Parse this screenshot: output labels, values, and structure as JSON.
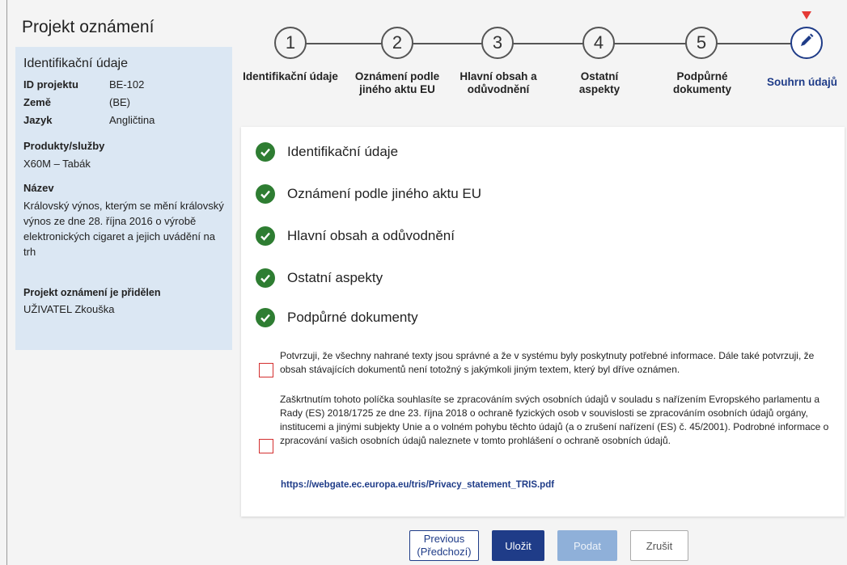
{
  "page": {
    "title": "Projekt oznámení"
  },
  "info": {
    "heading": "Identifikační údaje",
    "fields": [
      {
        "key": "ID projektu",
        "value": "BE-102"
      },
      {
        "key": "Země",
        "value": "(BE)"
      },
      {
        "key": "Jazyk",
        "value": "Angličtina"
      }
    ],
    "products_label": "Produkty/služby",
    "products_value": "X60M – Tabák",
    "name_label": "Název",
    "name_value": "Královský výnos, kterým se mění královský výnos ze dne 28. října 2016 o výrobě elektronických cigaret a jejich uvádění na trh",
    "assigned_label": "Projekt oznámení je přidělen",
    "assigned_value": "UŽIVATEL Zkouška"
  },
  "stepper": {
    "steps": [
      {
        "number": "1",
        "label": "Identifikační údaje"
      },
      {
        "number": "2",
        "label": "Oznámení podle jiného aktu EU"
      },
      {
        "number": "3",
        "label": "Hlavní obsah a odůvodnění"
      },
      {
        "number": "4",
        "label": "Ostatní aspekty"
      },
      {
        "number": "5",
        "label": "Podpůrné dokumenty"
      }
    ],
    "current_label": "Souhrn údajů",
    "current_icon": "pencil-icon",
    "accent": "#1f3c88",
    "marker_color": "#e53935"
  },
  "summary": {
    "items": [
      "Identifikační údaje",
      "Oznámení podle jiného aktu EU",
      "Hlavní obsah a odůvodnění",
      "Ostatní aspekty",
      "Podpůrné dokumenty"
    ],
    "check_color": "#2e7d32",
    "confirm1": "Potvrzuji, že všechny nahrané texty jsou správné a že v systému byly poskytnuty potřebné informace. Dále také potvrzuji, že obsah stávajících dokumentů není totožný s jakýmkoli jiným textem, který byl dříve oznámen.",
    "confirm2": "Zaškrtnutím tohoto políčka souhlasíte se zpracováním svých osobních údajů v souladu s nařízením Evropského parlamentu a Rady (ES) 2018/1725 ze dne 23. října 2018 o ochraně fyzických osob v souvislosti se zpracováním osobních údajů orgány, institucemi a jinými subjekty Unie a o volném pohybu těchto údajů (a o zrušení nařízení (ES) č. 45/2001). Podrobné informace o zpracování vašich osobních údajů naleznete v tomto prohlášení o ochraně osobních údajů.",
    "privacy_link": "https://webgate.ec.europa.eu/tris/Privacy_statement_TRIS.pdf"
  },
  "buttons": {
    "previous_line1": "Previous",
    "previous_line2": "(Předchozí)",
    "save": "Uložit",
    "submit": "Podat",
    "cancel": "Zrušit"
  }
}
